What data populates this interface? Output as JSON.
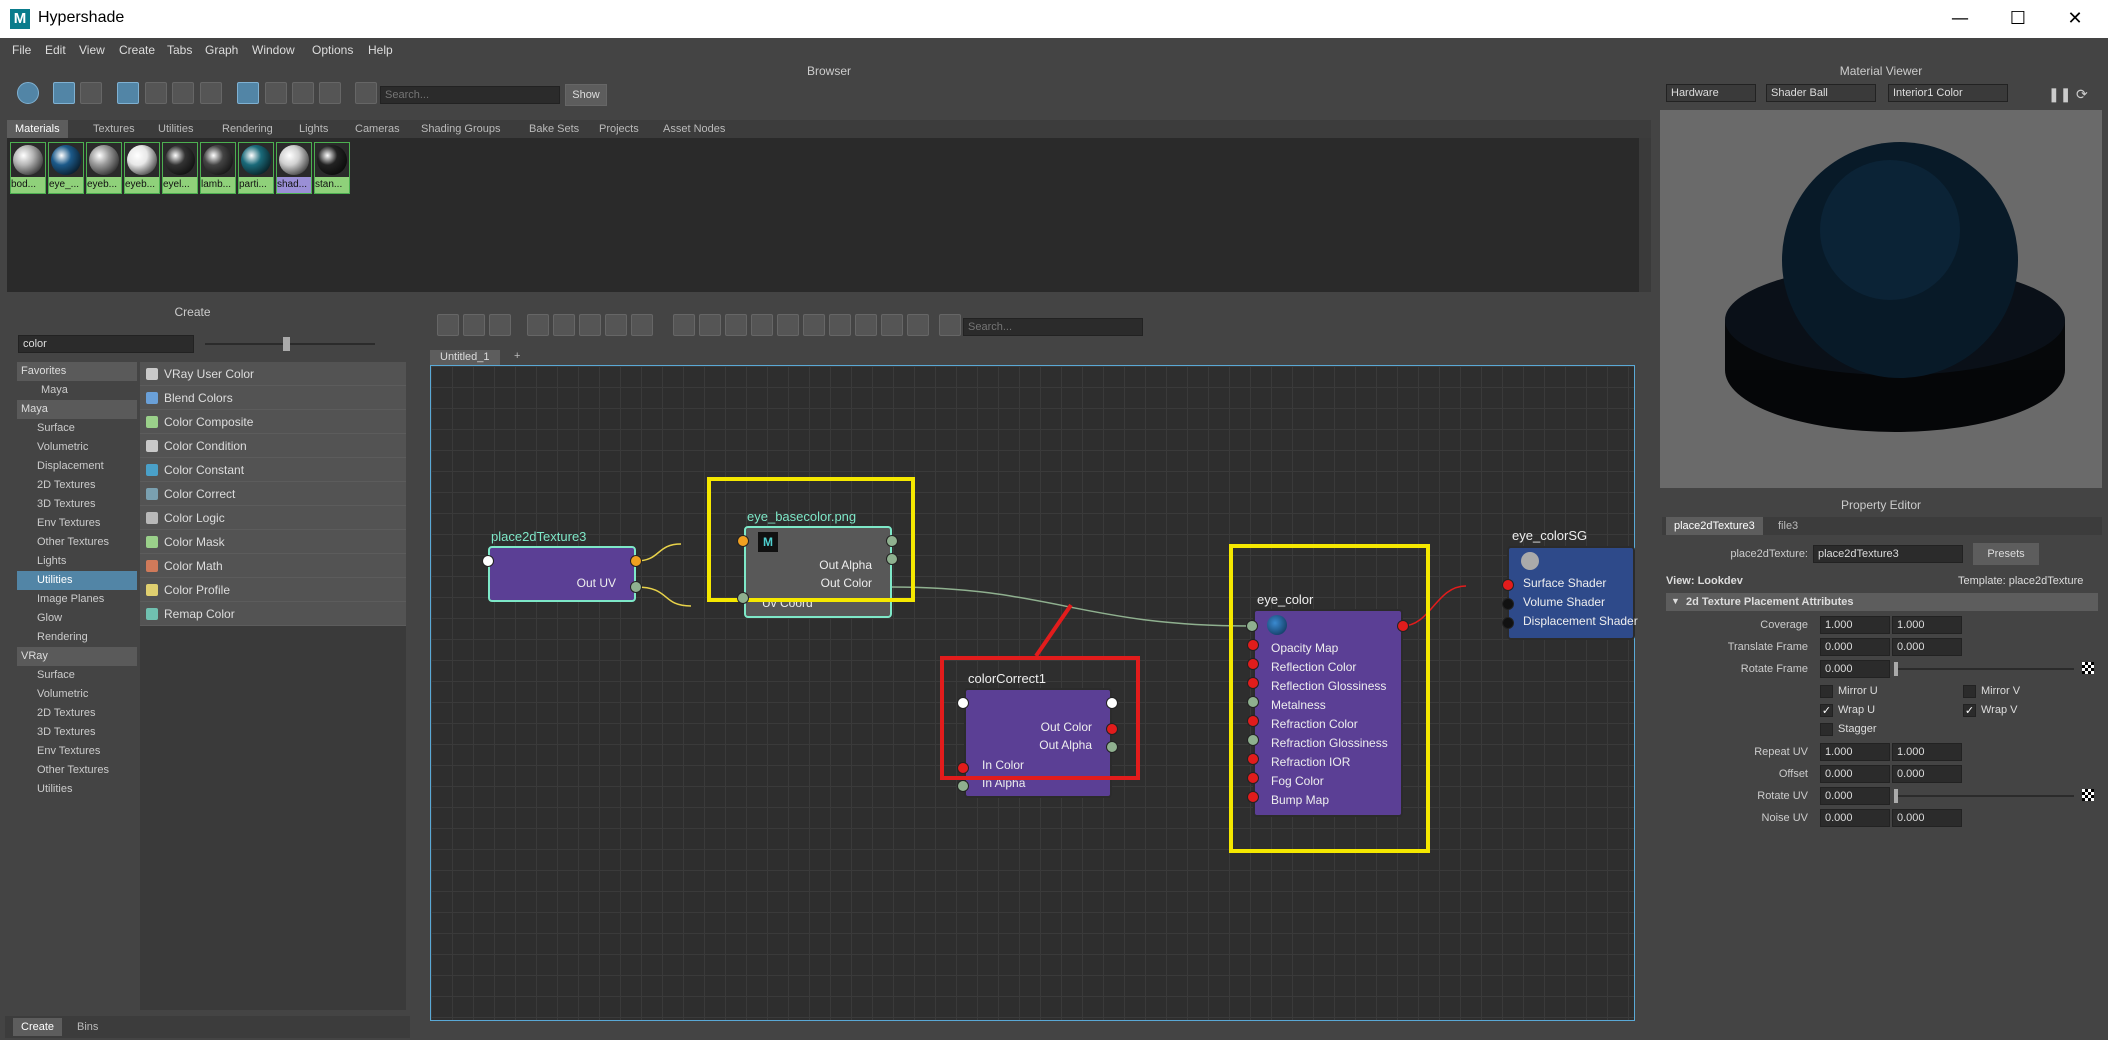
{
  "window": {
    "title": "Hypershade",
    "app_letter": "M",
    "minimize": "—",
    "maximize": "☐",
    "close": "✕"
  },
  "menu": [
    "File",
    "Edit",
    "View",
    "Create",
    "Tabs",
    "Graph",
    "Window",
    "Options",
    "Help"
  ],
  "browser": {
    "title": "Browser",
    "search_placeholder": "Search...",
    "show_label": "Show",
    "tabs": [
      "Materials",
      "Textures",
      "Utilities",
      "Rendering",
      "Lights",
      "Cameras",
      "Shading Groups",
      "Bake Sets",
      "Projects",
      "Asset Nodes"
    ],
    "swatches": [
      {
        "label": "bod...",
        "color": "#b5b5b5"
      },
      {
        "label": "eye_...",
        "color": "#1c5a8a"
      },
      {
        "label": "eyeb...",
        "color": "#9a9a9a"
      },
      {
        "label": "eyeb...",
        "color": "#e8e8e8"
      },
      {
        "label": "eyel...",
        "color": "#333333"
      },
      {
        "label": "lamb...",
        "color": "#444444"
      },
      {
        "label": "parti...",
        "color": "#1a6a7a"
      },
      {
        "label": "shad...",
        "color": "#d0d0d0"
      },
      {
        "label": "stan...",
        "color": "#222222"
      }
    ]
  },
  "create": {
    "title": "Create",
    "filter": "color",
    "categories": [
      {
        "label": "Favorites",
        "type": "hdr"
      },
      {
        "label": "Maya",
        "type": "sub"
      },
      {
        "label": "Maya",
        "type": "hdr"
      },
      {
        "label": "Surface"
      },
      {
        "label": "Volumetric"
      },
      {
        "label": "Displacement"
      },
      {
        "label": "2D Textures"
      },
      {
        "label": "3D Textures"
      },
      {
        "label": "Env Textures"
      },
      {
        "label": "Other Textures"
      },
      {
        "label": "Lights"
      },
      {
        "label": "Utilities",
        "type": "sel"
      },
      {
        "label": "Image Planes"
      },
      {
        "label": "Glow"
      },
      {
        "label": "Rendering"
      },
      {
        "label": "VRay",
        "type": "hdr"
      },
      {
        "label": "Surface"
      },
      {
        "label": "Volumetric"
      },
      {
        "label": "2D Textures"
      },
      {
        "label": "3D Textures"
      },
      {
        "label": "Env Textures"
      },
      {
        "label": "Other Textures"
      },
      {
        "label": "Utilities"
      }
    ],
    "nodes": [
      {
        "label": "VRay User Color",
        "color": "#c9c9c9"
      },
      {
        "label": "Blend Colors",
        "color": "#6aa0d8"
      },
      {
        "label": "Color Composite",
        "color": "#9ad08a"
      },
      {
        "label": "Color Condition",
        "color": "#c8c8c8"
      },
      {
        "label": "Color Constant",
        "color": "#4aa0c8"
      },
      {
        "label": "Color Correct",
        "color": "#7aa0b0"
      },
      {
        "label": "Color Logic",
        "color": "#b8b8b8"
      },
      {
        "label": "Color Mask",
        "color": "#9ad08a"
      },
      {
        "label": "Color Math",
        "color": "#d07a5a"
      },
      {
        "label": "Color Profile",
        "color": "#e0d070"
      },
      {
        "label": "Remap Color",
        "color": "#70c0b0"
      }
    ],
    "bottom_tabs": [
      "Create",
      "Bins"
    ]
  },
  "graph": {
    "search_placeholder": "Search...",
    "tab": "Untitled_1",
    "add_tab": "+",
    "nodes": {
      "place2d": {
        "title": "place2dTexture3",
        "out": "Out UV"
      },
      "file": {
        "title": "eye_basecolor.png",
        "out_alpha": "Out Alpha",
        "out_color": "Out Color",
        "uv": "Uv Coord"
      },
      "cc": {
        "title": "colorCorrect1",
        "out_color": "Out Color",
        "out_alpha": "Out Alpha",
        "in_color": "In Color",
        "in_alpha": "In Alpha"
      },
      "mat": {
        "title": "eye_color",
        "rows": [
          "Opacity Map",
          "Reflection Color",
          "Reflection Glossiness",
          "Metalness",
          "Refraction Color",
          "Refraction Glossiness",
          "Refraction IOR",
          "Fog Color",
          "Bump Map"
        ]
      },
      "sg": {
        "title": "eye_colorSG",
        "rows": [
          "Surface Shader",
          "Volume Shader",
          "Displacement Shader"
        ]
      }
    }
  },
  "viewer": {
    "title": "Material Viewer",
    "renderer": "Hardware",
    "shape": "Shader Ball",
    "env": "Interior1 Color"
  },
  "prop": {
    "title": "Property Editor",
    "tabs": [
      "place2dTexture3",
      "file3"
    ],
    "node_label": "place2dTexture:",
    "node_value": "place2dTexture3",
    "presets": "Presets",
    "view": "View: Lookdev",
    "template": "Template: place2dTexture",
    "section": "2d Texture Placement Attributes",
    "coverage": {
      "label": "Coverage",
      "u": "1.000",
      "v": "1.000"
    },
    "translate": {
      "label": "Translate Frame",
      "u": "0.000",
      "v": "0.000"
    },
    "rotate_frame": {
      "label": "Rotate Frame",
      "value": "0.000"
    },
    "mirror_u": {
      "label": "Mirror U",
      "checked": false
    },
    "mirror_v": {
      "label": "Mirror V",
      "checked": false
    },
    "wrap_u": {
      "label": "Wrap U",
      "checked": true
    },
    "wrap_v": {
      "label": "Wrap V",
      "checked": true
    },
    "stagger": {
      "label": "Stagger",
      "checked": false
    },
    "repeat": {
      "label": "Repeat UV",
      "u": "1.000",
      "v": "1.000"
    },
    "offset": {
      "label": "Offset",
      "u": "0.000",
      "v": "0.000"
    },
    "rotate_uv": {
      "label": "Rotate UV",
      "value": "0.000"
    },
    "noise": {
      "label": "Noise UV",
      "u": "0.000",
      "v": "0.000"
    }
  }
}
